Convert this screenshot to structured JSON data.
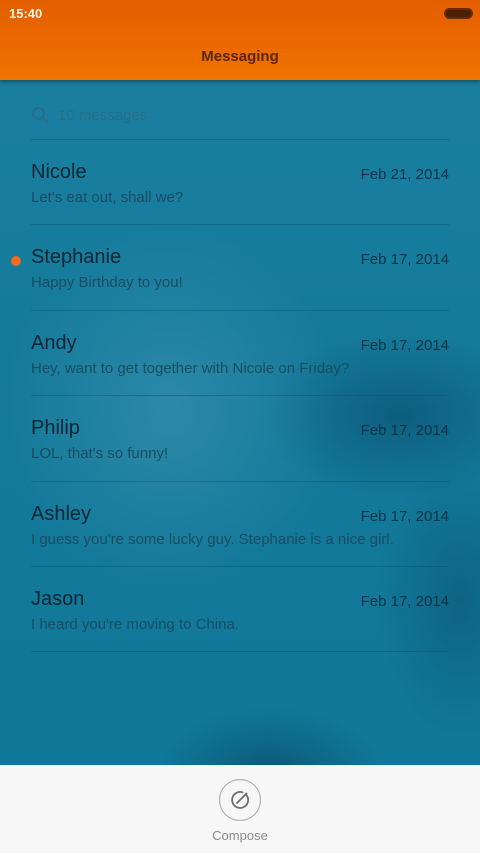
{
  "status_bar": {
    "time": "15:40"
  },
  "header": {
    "title": "Messaging"
  },
  "search": {
    "placeholder": "10 messages"
  },
  "messages": [
    {
      "name": "Nicole",
      "date": "Feb 21, 2014",
      "preview": "Let's eat out, shall we?",
      "unread": false
    },
    {
      "name": "Stephanie",
      "date": "Feb 17, 2014",
      "preview": "Happy Birthday to you!",
      "unread": true
    },
    {
      "name": "Andy",
      "date": "Feb 17, 2014",
      "preview": "Hey, want to get together with Nicole on Friday?",
      "unread": false
    },
    {
      "name": "Philip",
      "date": "Feb 17, 2014",
      "preview": "LOL, that's so funny!",
      "unread": false
    },
    {
      "name": "Ashley",
      "date": "Feb 17, 2014",
      "preview": "I guess you're some lucky guy. Stephanie is a nice girl.",
      "unread": false
    },
    {
      "name": "Jason",
      "date": "Feb 17, 2014",
      "preview": "I heard you're moving to China.",
      "unread": false
    }
  ],
  "bottom_bar": {
    "compose_label": "Compose"
  },
  "colors": {
    "accent": "#f07300",
    "unread_dot": "#f26a1b",
    "background": "#127c9c"
  },
  "icons": {
    "search": "search-icon",
    "compose": "compose-icon",
    "battery": "battery-icon"
  }
}
